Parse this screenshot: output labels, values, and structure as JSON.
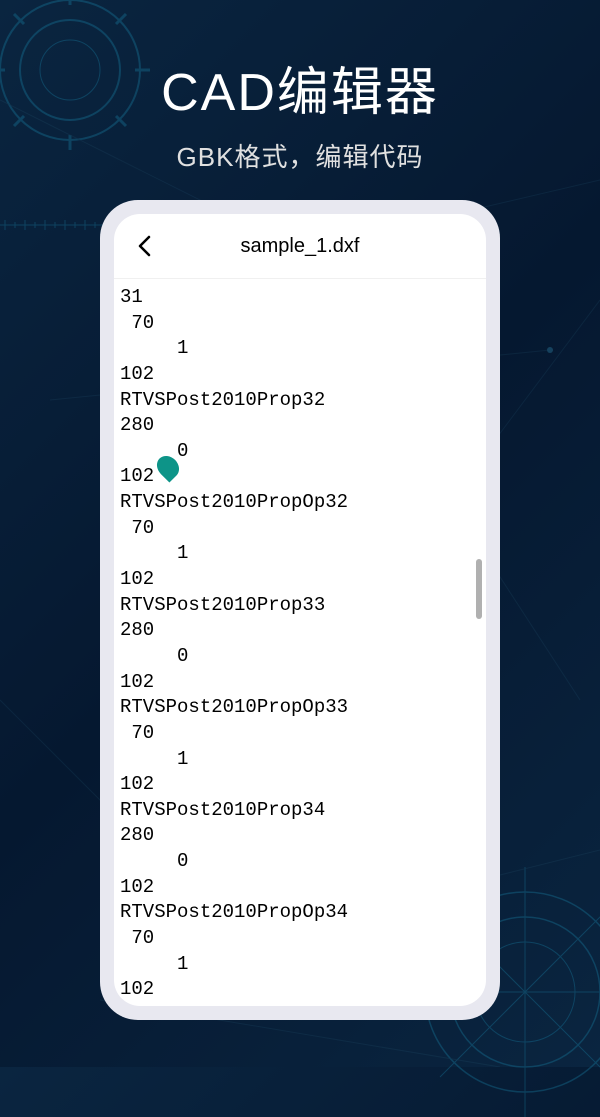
{
  "header": {
    "title": "CAD编辑器",
    "subtitle": "GBK格式，编辑代码"
  },
  "app": {
    "fileName": "sample_1.dxf"
  },
  "code": {
    "lines": [
      "31",
      " 70",
      "     1",
      "102",
      "RTVSPost2010Prop32",
      "280",
      "     0",
      "102",
      "RTVSPost2010PropOp32",
      " 70",
      "     1",
      "102",
      "RTVSPost2010Prop33",
      "280",
      "     0",
      "102",
      "RTVSPost2010PropOp33",
      " 70",
      "     1",
      "102",
      "RTVSPost2010Prop34",
      "280",
      "     0",
      "102",
      "RTVSPost2010PropOp34",
      " 70",
      "     1",
      "102"
    ]
  }
}
